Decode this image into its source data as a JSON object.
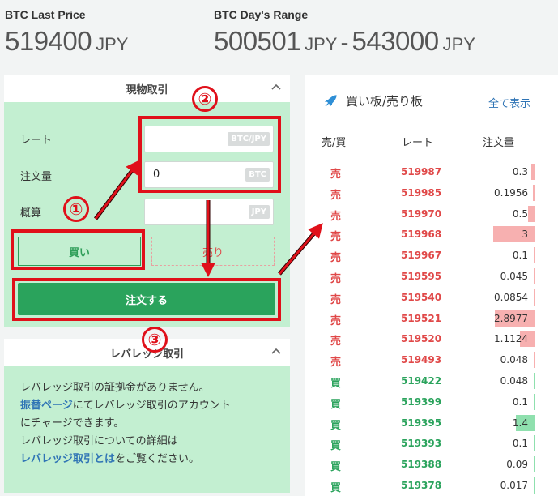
{
  "last_price": {
    "label": "BTC Last Price",
    "value": "519400",
    "unit": "JPY"
  },
  "day_range": {
    "label": "BTC Day's Range",
    "low": "500501",
    "low_unit": "JPY",
    "separator": "-",
    "high": "543000",
    "high_unit": "JPY"
  },
  "spot_panel": {
    "title": "現物取引",
    "rate_label": "レート",
    "rate_value": "",
    "rate_tag": "BTC/JPY",
    "amount_label": "注文量",
    "amount_value": "0",
    "amount_tag": "BTC",
    "estimate_label": "概算",
    "estimate_value": "",
    "estimate_tag": "JPY",
    "buy_label": "買い",
    "sell_label": "売り",
    "submit_label": "注文する"
  },
  "leverage_panel": {
    "title": "レバレッジ取引",
    "line1": "レバレッジ取引の証拠金がありません。",
    "line2_link": "振替ページ",
    "line2_rest": "にてレバレッジ取引のアカウント",
    "line3": "にチャージできます。",
    "line4": "レバレッジ取引についての詳細は",
    "line5_link": "レバレッジ取引とは",
    "line5_rest": "をご覧ください。"
  },
  "orderbook": {
    "title": "買い板/売り板",
    "show_all": "全て表示",
    "col_side": "売/買",
    "col_rate": "レート",
    "col_qty": "注文量",
    "max_qty": 3,
    "rows": [
      {
        "side": "売",
        "type": "ask",
        "rate": "519987",
        "qty": "0.3",
        "depth": 0.3
      },
      {
        "side": "売",
        "type": "ask",
        "rate": "519985",
        "qty": "0.1956",
        "depth": 0.1956
      },
      {
        "side": "売",
        "type": "ask",
        "rate": "519970",
        "qty": "0.5",
        "depth": 0.5
      },
      {
        "side": "売",
        "type": "ask",
        "rate": "519968",
        "qty": "3",
        "depth": 3
      },
      {
        "side": "売",
        "type": "ask",
        "rate": "519967",
        "qty": "0.1",
        "depth": 0.1
      },
      {
        "side": "売",
        "type": "ask",
        "rate": "519595",
        "qty": "0.045",
        "depth": 0.045
      },
      {
        "side": "売",
        "type": "ask",
        "rate": "519540",
        "qty": "0.0854",
        "depth": 0.0854
      },
      {
        "side": "売",
        "type": "ask",
        "rate": "519521",
        "qty": "2.8977",
        "depth": 2.8977
      },
      {
        "side": "売",
        "type": "ask",
        "rate": "519520",
        "qty": "1.1124",
        "depth": 1.1124
      },
      {
        "side": "売",
        "type": "ask",
        "rate": "519493",
        "qty": "0.048",
        "depth": 0.048
      },
      {
        "side": "買",
        "type": "bid",
        "rate": "519422",
        "qty": "0.048",
        "depth": 0.048
      },
      {
        "side": "買",
        "type": "bid",
        "rate": "519399",
        "qty": "0.1",
        "depth": 0.1
      },
      {
        "side": "買",
        "type": "bid",
        "rate": "519395",
        "qty": "1.4",
        "depth": 1.4
      },
      {
        "side": "買",
        "type": "bid",
        "rate": "519393",
        "qty": "0.1",
        "depth": 0.1
      },
      {
        "side": "買",
        "type": "bid",
        "rate": "519388",
        "qty": "0.09",
        "depth": 0.09
      },
      {
        "side": "買",
        "type": "bid",
        "rate": "519378",
        "qty": "0.017",
        "depth": 0.017
      }
    ]
  },
  "annotations": {
    "step1": "①",
    "step2": "②",
    "step3": "③"
  },
  "colors": {
    "ask": "#e04848",
    "bid": "#2aa35c",
    "ask_bar": "#f7b0b0",
    "bid_bar": "#8fe0ae",
    "annotation": "#e0101a"
  },
  "icons": {
    "rocket": "rocket-icon",
    "chevron": "chevron-up-icon"
  }
}
